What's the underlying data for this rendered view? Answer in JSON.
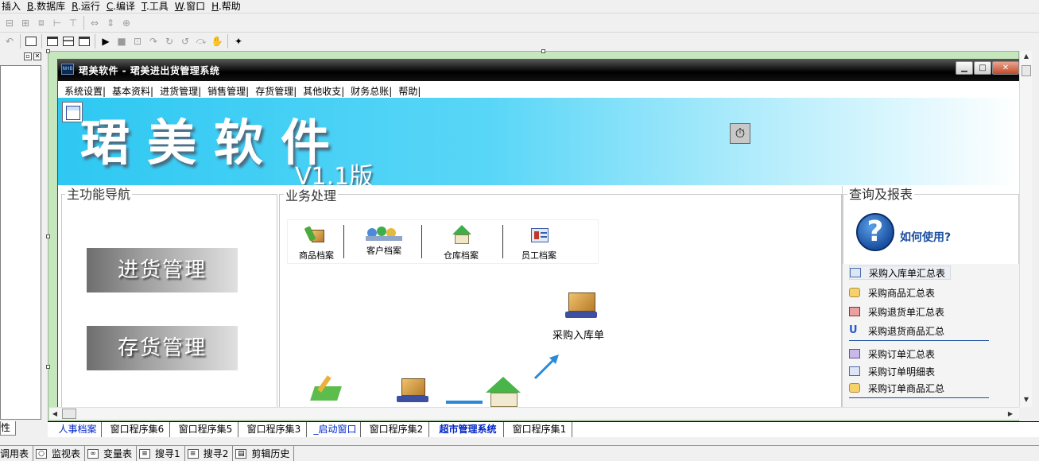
{
  "ide": {
    "menu": [
      {
        "label": "插入"
      },
      {
        "key": "B",
        "label": ".数据库"
      },
      {
        "key": "R",
        "label": ".运行"
      },
      {
        "key": "C",
        "label": ".编译"
      },
      {
        "key": "T",
        "label": ".工具"
      },
      {
        "key": "W",
        "label": ".窗口"
      },
      {
        "key": "H",
        "label": ".帮助"
      }
    ],
    "left_dock_tab": "性"
  },
  "app_window": {
    "title": "珺美软件 - 珺美进出货管理系统",
    "controls": {
      "minimize": "▁",
      "maximize": "□",
      "close": "✕"
    },
    "menu": [
      "系统设置|",
      "基本资料|",
      "进货管理|",
      "销售管理|",
      "存货管理|",
      "其他收支|",
      "财务总账|",
      "帮助|"
    ],
    "banner": {
      "brand": "珺美软件",
      "version": "V1.1版"
    },
    "nav": {
      "title": "主功能导航",
      "buttons": [
        "进货管理",
        "存货管理"
      ]
    },
    "business": {
      "title": "业务处理",
      "ribbon": [
        "商品档案",
        "客户档案",
        "仓库档案",
        "员工档案"
      ],
      "flow_label": "采购入库单"
    },
    "reports": {
      "title": "查询及报表",
      "help_label": "如何使用?",
      "items": [
        "采购入库单汇总表",
        "采购商品汇总表",
        "采购退货单汇总表",
        "采购退货商品汇总",
        "采购订单汇总表",
        "采购订单明细表",
        "采购订单商品汇总"
      ]
    }
  },
  "window_tabs": [
    "人事档案",
    "窗口程序集6",
    "窗口程序集5",
    "窗口程序集3",
    "_启动窗口",
    "窗口程序集2",
    "超市管理系统",
    "窗口程序集1"
  ],
  "active_tab": "超市管理系统",
  "status_bar": [
    "调用表",
    "监视表",
    "变量表",
    "搜寻1",
    "搜寻2",
    "剪辑历史"
  ]
}
